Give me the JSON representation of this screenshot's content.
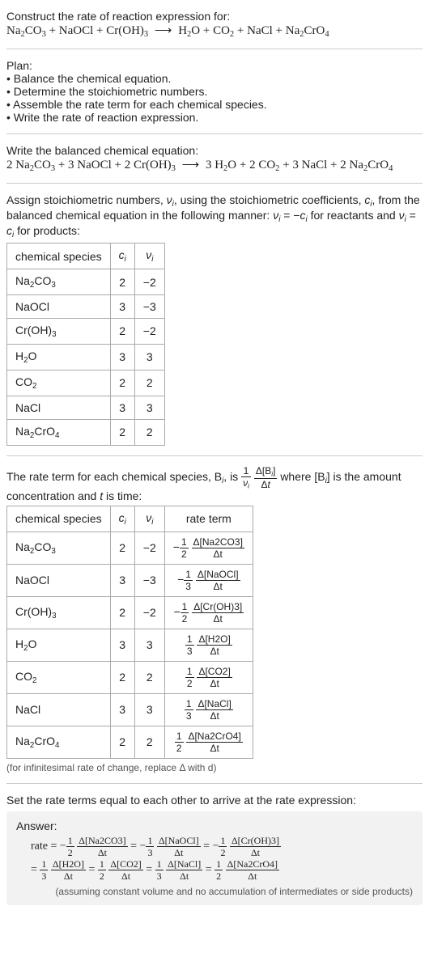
{
  "header": {
    "prompt": "Construct the rate of reaction expression for:",
    "equation_html": "Na<sub>2</sub>CO<sub>3</sub> + NaOCl + Cr(OH)<sub>3</sub> <span class='arrow'>⟶</span> H<sub>2</sub>O + CO<sub>2</sub> + NaCl + Na<sub>2</sub>CrO<sub>4</sub>"
  },
  "plan": {
    "title": "Plan:",
    "items": [
      "Balance the chemical equation.",
      "Determine the stoichiometric numbers.",
      "Assemble the rate term for each chemical species.",
      "Write the rate of reaction expression."
    ]
  },
  "balanced": {
    "title": "Write the balanced chemical equation:",
    "equation_html": "2 Na<sub>2</sub>CO<sub>3</sub> + 3 NaOCl + 2 Cr(OH)<sub>3</sub> <span class='arrow'>⟶</span> 3 H<sub>2</sub>O + 2 CO<sub>2</sub> + 3 NaCl + 2 Na<sub>2</sub>CrO<sub>4</sub>"
  },
  "stoich_intro_html": "Assign stoichiometric numbers, <i>ν<sub>i</sub></i>, using the stoichiometric coefficients, <i>c<sub>i</sub></i>, from the balanced chemical equation in the following manner: <i>ν<sub>i</sub></i> = −<i>c<sub>i</sub></i> for reactants and <i>ν<sub>i</sub></i> = <i>c<sub>i</sub></i> for products:",
  "table1": {
    "headers": [
      "chemical species",
      "c_i",
      "ν_i"
    ],
    "rows": [
      {
        "species_html": "Na<sub>2</sub>CO<sub>3</sub>",
        "c": "2",
        "nu": "−2"
      },
      {
        "species_html": "NaOCl",
        "c": "3",
        "nu": "−3"
      },
      {
        "species_html": "Cr(OH)<sub>3</sub>",
        "c": "2",
        "nu": "−2"
      },
      {
        "species_html": "H<sub>2</sub>O",
        "c": "3",
        "nu": "3"
      },
      {
        "species_html": "CO<sub>2</sub>",
        "c": "2",
        "nu": "2"
      },
      {
        "species_html": "NaCl",
        "c": "3",
        "nu": "3"
      },
      {
        "species_html": "Na<sub>2</sub>CrO<sub>4</sub>",
        "c": "2",
        "nu": "2"
      }
    ]
  },
  "rate_term_intro_pre": "The rate term for each chemical species, B",
  "rate_term_intro_mid": ", is ",
  "rate_term_intro_post_html": " where [B<sub><i>i</i></sub>] is the amount concentration and <i>t</i> is time:",
  "rate_term_frac1_num": "1",
  "rate_term_frac1_den_html": "<i>ν<sub>i</sub></i>",
  "rate_term_frac2_num_html": "Δ[B<sub><i>i</i></sub>]",
  "rate_term_frac2_den_html": "Δ<i>t</i>",
  "table2": {
    "headers": [
      "chemical species",
      "c_i",
      "ν_i",
      "rate term"
    ],
    "rows": [
      {
        "species_html": "Na<sub>2</sub>CO<sub>3</sub>",
        "c": "2",
        "nu": "−2",
        "sign": "−",
        "coef_num": "1",
        "coef_den": "2",
        "delta_num": "Δ[Na2CO3]",
        "delta_den": "Δt"
      },
      {
        "species_html": "NaOCl",
        "c": "3",
        "nu": "−3",
        "sign": "−",
        "coef_num": "1",
        "coef_den": "3",
        "delta_num": "Δ[NaOCl]",
        "delta_den": "Δt"
      },
      {
        "species_html": "Cr(OH)<sub>3</sub>",
        "c": "2",
        "nu": "−2",
        "sign": "−",
        "coef_num": "1",
        "coef_den": "2",
        "delta_num": "Δ[Cr(OH)3]",
        "delta_den": "Δt"
      },
      {
        "species_html": "H<sub>2</sub>O",
        "c": "3",
        "nu": "3",
        "sign": "",
        "coef_num": "1",
        "coef_den": "3",
        "delta_num": "Δ[H2O]",
        "delta_den": "Δt"
      },
      {
        "species_html": "CO<sub>2</sub>",
        "c": "2",
        "nu": "2",
        "sign": "",
        "coef_num": "1",
        "coef_den": "2",
        "delta_num": "Δ[CO2]",
        "delta_den": "Δt"
      },
      {
        "species_html": "NaCl",
        "c": "3",
        "nu": "3",
        "sign": "",
        "coef_num": "1",
        "coef_den": "3",
        "delta_num": "Δ[NaCl]",
        "delta_den": "Δt"
      },
      {
        "species_html": "Na<sub>2</sub>CrO<sub>4</sub>",
        "c": "2",
        "nu": "2",
        "sign": "",
        "coef_num": "1",
        "coef_den": "2",
        "delta_num": "Δ[Na2CrO4]",
        "delta_den": "Δt"
      }
    ]
  },
  "infinitesimal_note": "(for infinitesimal rate of change, replace Δ with d)",
  "set_equal_text": "Set the rate terms equal to each other to arrive at the rate expression:",
  "answer": {
    "label": "Answer:",
    "rate_label": "rate",
    "terms": [
      {
        "sign": "−",
        "coef_num": "1",
        "coef_den": "2",
        "delta_num": "Δ[Na2CO3]",
        "delta_den": "Δt"
      },
      {
        "sign": "−",
        "coef_num": "1",
        "coef_den": "3",
        "delta_num": "Δ[NaOCl]",
        "delta_den": "Δt"
      },
      {
        "sign": "−",
        "coef_num": "1",
        "coef_den": "2",
        "delta_num": "Δ[Cr(OH)3]",
        "delta_den": "Δt"
      },
      {
        "sign": "",
        "coef_num": "1",
        "coef_den": "3",
        "delta_num": "Δ[H2O]",
        "delta_den": "Δt"
      },
      {
        "sign": "",
        "coef_num": "1",
        "coef_den": "2",
        "delta_num": "Δ[CO2]",
        "delta_den": "Δt"
      },
      {
        "sign": "",
        "coef_num": "1",
        "coef_den": "3",
        "delta_num": "Δ[NaCl]",
        "delta_den": "Δt"
      },
      {
        "sign": "",
        "coef_num": "1",
        "coef_den": "2",
        "delta_num": "Δ[Na2CrO4]",
        "delta_den": "Δt"
      }
    ],
    "note": "(assuming constant volume and no accumulation of intermediates or side products)"
  }
}
